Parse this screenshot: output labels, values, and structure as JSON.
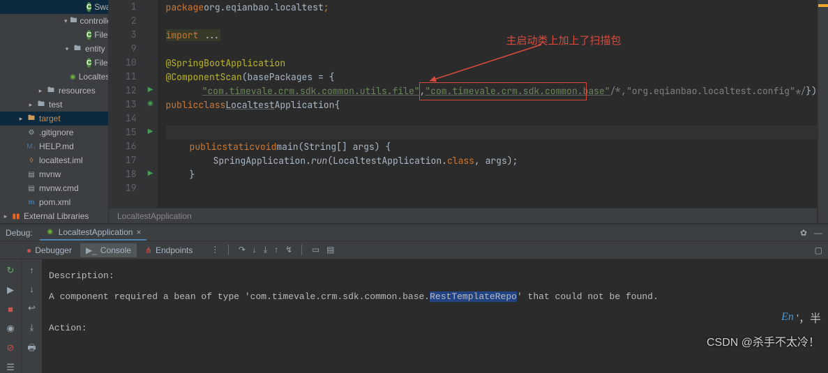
{
  "tree": {
    "i0": "SwaagerConfig",
    "i1": "controller",
    "i2": "FileSystemController",
    "i3": "entity",
    "i4": "FileResult",
    "i5": "LocaltestApplication",
    "i6": "resources",
    "i7": "test",
    "i8": "target",
    "i9": ".gitignore",
    "i10": "HELP.md",
    "i11": "localtest.iml",
    "i12": "mvnw",
    "i13": "mvnw.cmd",
    "i14": "pom.xml",
    "i15": "External Libraries"
  },
  "code": {
    "ln1": "1",
    "ln2": "2",
    "ln3": "3",
    "ln9": "9",
    "ln10": "10",
    "ln11": "11",
    "ln12": "12",
    "ln13": "13",
    "ln14": "14",
    "ln15": "15",
    "ln16": "16",
    "ln17": "17",
    "ln18": "18",
    "ln19": "19",
    "pkg_kw": "package ",
    "pkg_val": "org.eqianbao.localtest",
    "import_kw": "import",
    "import_rest": " ...",
    "anno1": "@SpringBootApplication",
    "anno2": "@ComponentScan",
    "anno2_open": "(basePackages = {",
    "str1": "\"com.timevale.crm.sdk.common.utils.file\"",
    "c1": ",",
    "str2": "\"com.timevale.crm.sdk.common.base\"",
    "cmt": "/*,\"org.eqianbao.localtest.config\"*/",
    "anno2_close": "})",
    "pub": "public ",
    "cls": "class ",
    "clsname": "Localtest",
    "clsname2": "Application",
    " open": " {",
    "pub2": "public ",
    "static": "static ",
    "void": "void ",
    "main": "main",
    "mainsig": "(String[] args) {",
    "run1": "SpringApplication.",
    "run2": "run",
    "runargs": "(LocaltestApplication.",
    "runcls": "class",
    "runend": ", args);",
    "brace_c": "}",
    "breadcrumb": "LocaltestApplication"
  },
  "annotation": {
    "text": "主启动类上加上了扫描包"
  },
  "debug": {
    "title": "Debug:",
    "config": "LocaltestApplication",
    "tab_debugger": "Debugger",
    "tab_console": "Console",
    "tab_endpoints": "Endpoints",
    "desc": "Description:",
    "msg_a": "A component required a bean of type '",
    "msg_b": "com.timevale.crm.sdk.common.base.",
    "msg_hi": "RestTemplateRepo",
    "msg_c": "' that could not be found.",
    "action": "Action:"
  },
  "ime": {
    "a": "En",
    "b": "'，半"
  },
  "watermark": "CSDN @杀手不太冷！"
}
